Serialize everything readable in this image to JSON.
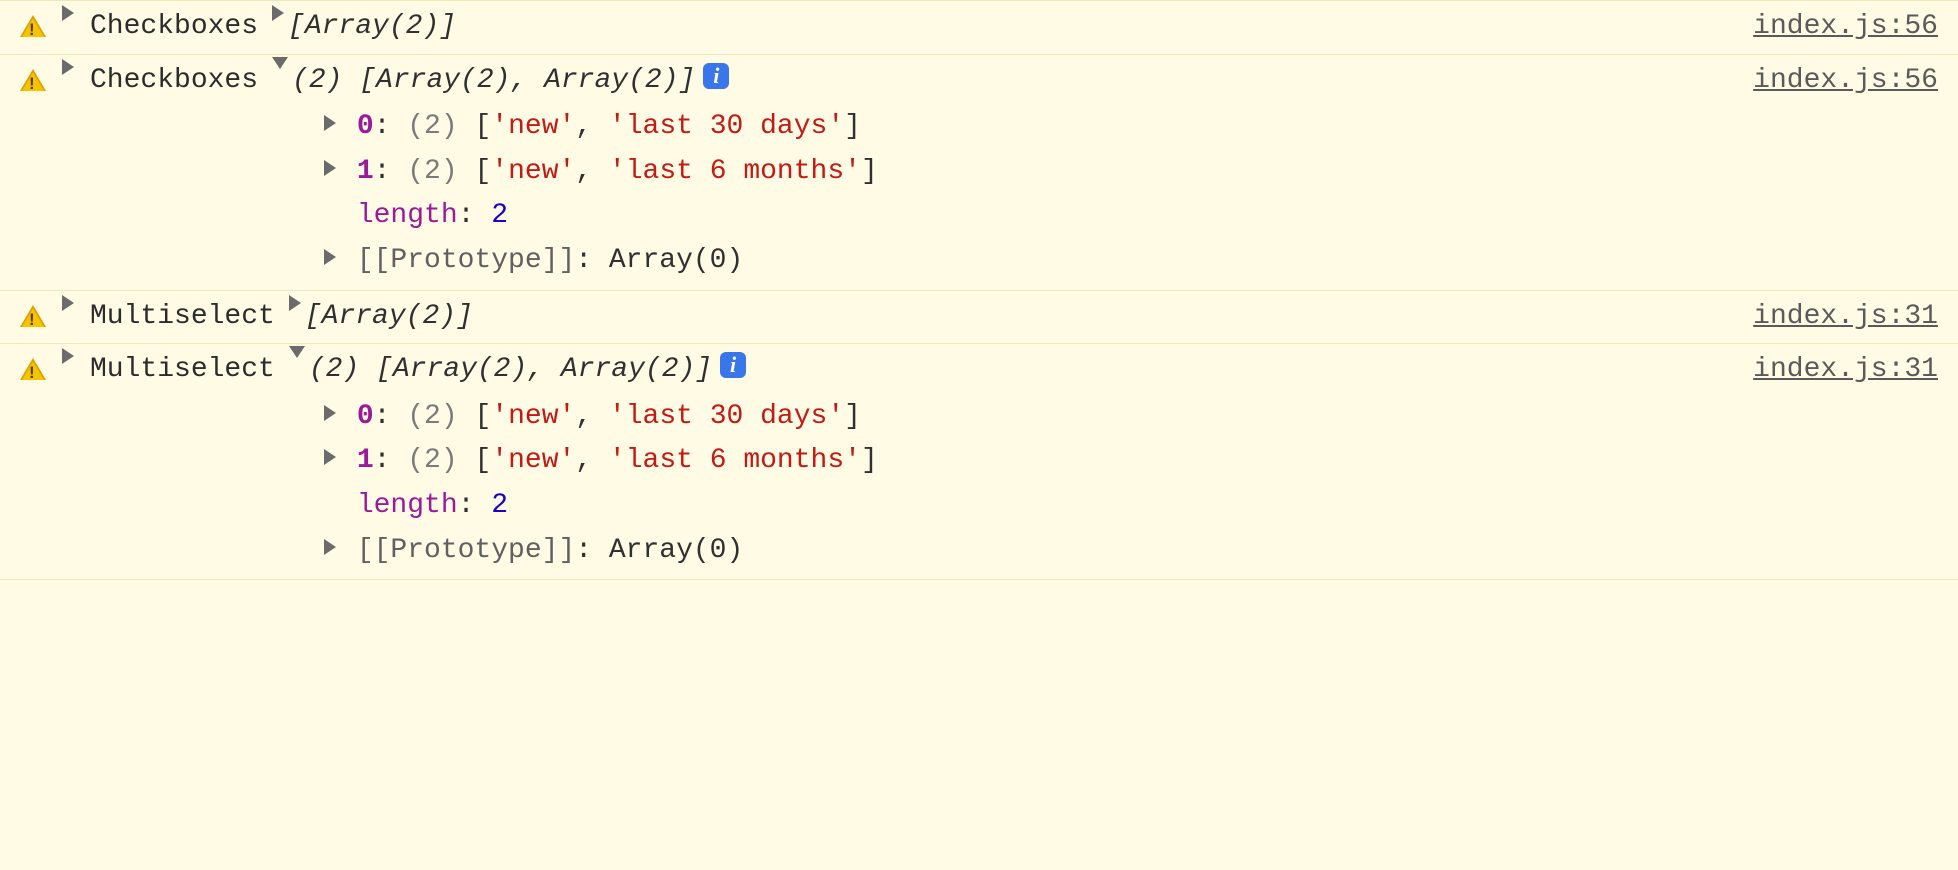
{
  "rows": [
    {
      "label": "Checkboxes",
      "collapsed": true,
      "preview": "[Array(2)]",
      "src": "index.js:56"
    },
    {
      "label": "Checkboxes",
      "collapsed": false,
      "preview": "(2) [Array(2), Array(2)]",
      "src": "index.js:56",
      "items": [
        {
          "idx": "0",
          "cnt": "(2)",
          "vals": [
            "'new'",
            "'last 30 days'"
          ]
        },
        {
          "idx": "1",
          "cnt": "(2)",
          "vals": [
            "'new'",
            "'last 6 months'"
          ]
        }
      ],
      "length_key": "length",
      "length_val": "2",
      "proto_key": "[[Prototype]]",
      "proto_val": "Array(0)"
    },
    {
      "label": "Multiselect",
      "collapsed": true,
      "preview": "[Array(2)]",
      "src": "index.js:31"
    },
    {
      "label": "Multiselect",
      "collapsed": false,
      "preview": "(2) [Array(2), Array(2)]",
      "src": "index.js:31",
      "items": [
        {
          "idx": "0",
          "cnt": "(2)",
          "vals": [
            "'new'",
            "'last 30 days'"
          ]
        },
        {
          "idx": "1",
          "cnt": "(2)",
          "vals": [
            "'new'",
            "'last 6 months'"
          ]
        }
      ],
      "length_key": "length",
      "length_val": "2",
      "proto_key": "[[Prototype]]",
      "proto_val": "Array(0)"
    }
  ]
}
